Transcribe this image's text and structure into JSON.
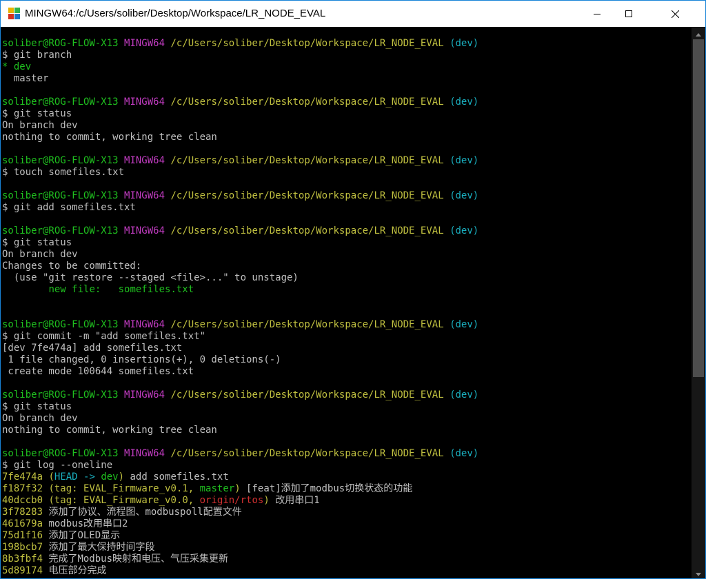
{
  "window": {
    "title": "MINGW64:/c/Users/soliber/Desktop/Workspace/LR_NODE_EVAL"
  },
  "colors": {
    "user_host": "#1fc01f",
    "system": "#c13cc1",
    "path": "#c0c040",
    "branch": "#1ab0c0",
    "text": "#c0c0c0",
    "remote": "#d03030",
    "titlebar_border": "#1883d7"
  },
  "icons": {
    "app": "mingw-icon",
    "minimize": "minimize-icon",
    "maximize": "maximize-icon",
    "close": "close-icon"
  },
  "terminal": {
    "lines": [
      [
        {
          "t": "soliber@ROG-FLOW-X13",
          "c": "c-user"
        },
        {
          "t": " "
        },
        {
          "t": "MINGW64",
          "c": "c-sys"
        },
        {
          "t": " "
        },
        {
          "t": "/c/Users/soliber/Desktop/Workspace/LR_NODE_EVAL",
          "c": "c-path"
        },
        {
          "t": " "
        },
        {
          "t": "(dev)",
          "c": "c-brn"
        }
      ],
      [
        {
          "t": "$ git branch"
        }
      ],
      [
        {
          "t": "* dev",
          "c": "c-grn"
        }
      ],
      [
        {
          "t": "  master"
        }
      ],
      [],
      [
        {
          "t": "soliber@ROG-FLOW-X13",
          "c": "c-user"
        },
        {
          "t": " "
        },
        {
          "t": "MINGW64",
          "c": "c-sys"
        },
        {
          "t": " "
        },
        {
          "t": "/c/Users/soliber/Desktop/Workspace/LR_NODE_EVAL",
          "c": "c-path"
        },
        {
          "t": " "
        },
        {
          "t": "(dev)",
          "c": "c-brn"
        }
      ],
      [
        {
          "t": "$ git status"
        }
      ],
      [
        {
          "t": "On branch dev"
        }
      ],
      [
        {
          "t": "nothing to commit, working tree clean"
        }
      ],
      [],
      [
        {
          "t": "soliber@ROG-FLOW-X13",
          "c": "c-user"
        },
        {
          "t": " "
        },
        {
          "t": "MINGW64",
          "c": "c-sys"
        },
        {
          "t": " "
        },
        {
          "t": "/c/Users/soliber/Desktop/Workspace/LR_NODE_EVAL",
          "c": "c-path"
        },
        {
          "t": " "
        },
        {
          "t": "(dev)",
          "c": "c-brn"
        }
      ],
      [
        {
          "t": "$ touch somefiles.txt"
        }
      ],
      [],
      [
        {
          "t": "soliber@ROG-FLOW-X13",
          "c": "c-user"
        },
        {
          "t": " "
        },
        {
          "t": "MINGW64",
          "c": "c-sys"
        },
        {
          "t": " "
        },
        {
          "t": "/c/Users/soliber/Desktop/Workspace/LR_NODE_EVAL",
          "c": "c-path"
        },
        {
          "t": " "
        },
        {
          "t": "(dev)",
          "c": "c-brn"
        }
      ],
      [
        {
          "t": "$ git add somefiles.txt"
        }
      ],
      [],
      [
        {
          "t": "soliber@ROG-FLOW-X13",
          "c": "c-user"
        },
        {
          "t": " "
        },
        {
          "t": "MINGW64",
          "c": "c-sys"
        },
        {
          "t": " "
        },
        {
          "t": "/c/Users/soliber/Desktop/Workspace/LR_NODE_EVAL",
          "c": "c-path"
        },
        {
          "t": " "
        },
        {
          "t": "(dev)",
          "c": "c-brn"
        }
      ],
      [
        {
          "t": "$ git status"
        }
      ],
      [
        {
          "t": "On branch dev"
        }
      ],
      [
        {
          "t": "Changes to be committed:"
        }
      ],
      [
        {
          "t": "  (use \"git restore --staged <file>...\" to unstage)"
        }
      ],
      [
        {
          "t": "        "
        },
        {
          "t": "new file:   somefiles.txt",
          "c": "c-grn"
        }
      ],
      [],
      [],
      [
        {
          "t": "soliber@ROG-FLOW-X13",
          "c": "c-user"
        },
        {
          "t": " "
        },
        {
          "t": "MINGW64",
          "c": "c-sys"
        },
        {
          "t": " "
        },
        {
          "t": "/c/Users/soliber/Desktop/Workspace/LR_NODE_EVAL",
          "c": "c-path"
        },
        {
          "t": " "
        },
        {
          "t": "(dev)",
          "c": "c-brn"
        }
      ],
      [
        {
          "t": "$ git commit -m \"add somefiles.txt\""
        }
      ],
      [
        {
          "t": "[dev 7fe474a] add somefiles.txt"
        }
      ],
      [
        {
          "t": " 1 file changed, 0 insertions(+), 0 deletions(-)"
        }
      ],
      [
        {
          "t": " create mode 100644 somefiles.txt"
        }
      ],
      [],
      [
        {
          "t": "soliber@ROG-FLOW-X13",
          "c": "c-user"
        },
        {
          "t": " "
        },
        {
          "t": "MINGW64",
          "c": "c-sys"
        },
        {
          "t": " "
        },
        {
          "t": "/c/Users/soliber/Desktop/Workspace/LR_NODE_EVAL",
          "c": "c-path"
        },
        {
          "t": " "
        },
        {
          "t": "(dev)",
          "c": "c-brn"
        }
      ],
      [
        {
          "t": "$ git status"
        }
      ],
      [
        {
          "t": "On branch dev"
        }
      ],
      [
        {
          "t": "nothing to commit, working tree clean"
        }
      ],
      [],
      [
        {
          "t": "soliber@ROG-FLOW-X13",
          "c": "c-user"
        },
        {
          "t": " "
        },
        {
          "t": "MINGW64",
          "c": "c-sys"
        },
        {
          "t": " "
        },
        {
          "t": "/c/Users/soliber/Desktop/Workspace/LR_NODE_EVAL",
          "c": "c-path"
        },
        {
          "t": " "
        },
        {
          "t": "(dev)",
          "c": "c-brn"
        }
      ],
      [
        {
          "t": "$ git log --oneline"
        }
      ],
      [
        {
          "t": "7fe474a",
          "c": "c-yel"
        },
        {
          "t": " "
        },
        {
          "t": "(",
          "c": "c-yel"
        },
        {
          "t": "HEAD -> ",
          "c": "c-head"
        },
        {
          "t": "dev",
          "c": "c-grn"
        },
        {
          "t": ")",
          "c": "c-yel"
        },
        {
          "t": " add somefiles.txt"
        }
      ],
      [
        {
          "t": "f187f32",
          "c": "c-yel"
        },
        {
          "t": " "
        },
        {
          "t": "(tag: EVAL_Firmware_v0.1, ",
          "c": "c-yel"
        },
        {
          "t": "master",
          "c": "c-grn"
        },
        {
          "t": ")",
          "c": "c-yel"
        },
        {
          "t": " [feat]添加了modbus切换状态的功能"
        }
      ],
      [
        {
          "t": "40dccb0",
          "c": "c-yel"
        },
        {
          "t": " "
        },
        {
          "t": "(tag: EVAL_Firmware_v0.0, ",
          "c": "c-yel"
        },
        {
          "t": "origin/rtos",
          "c": "c-red"
        },
        {
          "t": ")",
          "c": "c-yel"
        },
        {
          "t": " 改用串口1"
        }
      ],
      [
        {
          "t": "3f78283",
          "c": "c-yel"
        },
        {
          "t": " 添加了协议、流程图、modbuspoll配置文件"
        }
      ],
      [
        {
          "t": "461679a",
          "c": "c-yel"
        },
        {
          "t": " modbus改用串口2"
        }
      ],
      [
        {
          "t": "75d1f16",
          "c": "c-yel"
        },
        {
          "t": " 添加了OLED显示"
        }
      ],
      [
        {
          "t": "198bcb7",
          "c": "c-yel"
        },
        {
          "t": " 添加了最大保持时间字段"
        }
      ],
      [
        {
          "t": "8b3fbf4",
          "c": "c-yel"
        },
        {
          "t": " 完成了Modbus映射和电压、气压采集更新"
        }
      ],
      [
        {
          "t": "5d89174",
          "c": "c-yel"
        },
        {
          "t": " 电压部分完成"
        }
      ]
    ]
  }
}
